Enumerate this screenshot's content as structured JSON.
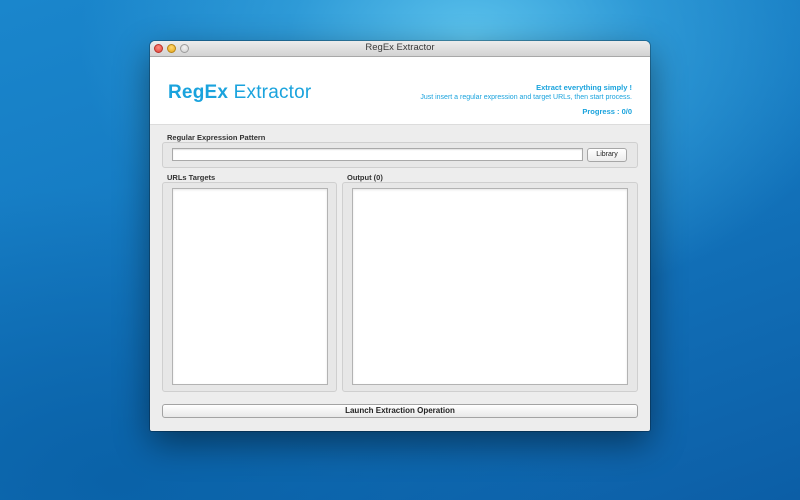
{
  "window": {
    "title": "RegEx Extractor"
  },
  "header": {
    "app_name_bold": "RegEx",
    "app_name_rest": " Extractor",
    "tagline_title": "Extract everything simply !",
    "tagline_sub": "Just insert a regular expression and target URLs, then start process.",
    "progress": "Progress : 0/0"
  },
  "pattern": {
    "label": "Regular Expression Pattern",
    "value": "",
    "library_label": "Library"
  },
  "urls": {
    "label": "URLs Targets",
    "value": ""
  },
  "output": {
    "label": "Output (0)",
    "value": ""
  },
  "actions": {
    "launch_label": "Launch Extraction Operation"
  },
  "colors": {
    "accent": "#1aa3dd"
  },
  "icons": [
    "close-icon",
    "minimize-icon",
    "zoom-icon"
  ]
}
